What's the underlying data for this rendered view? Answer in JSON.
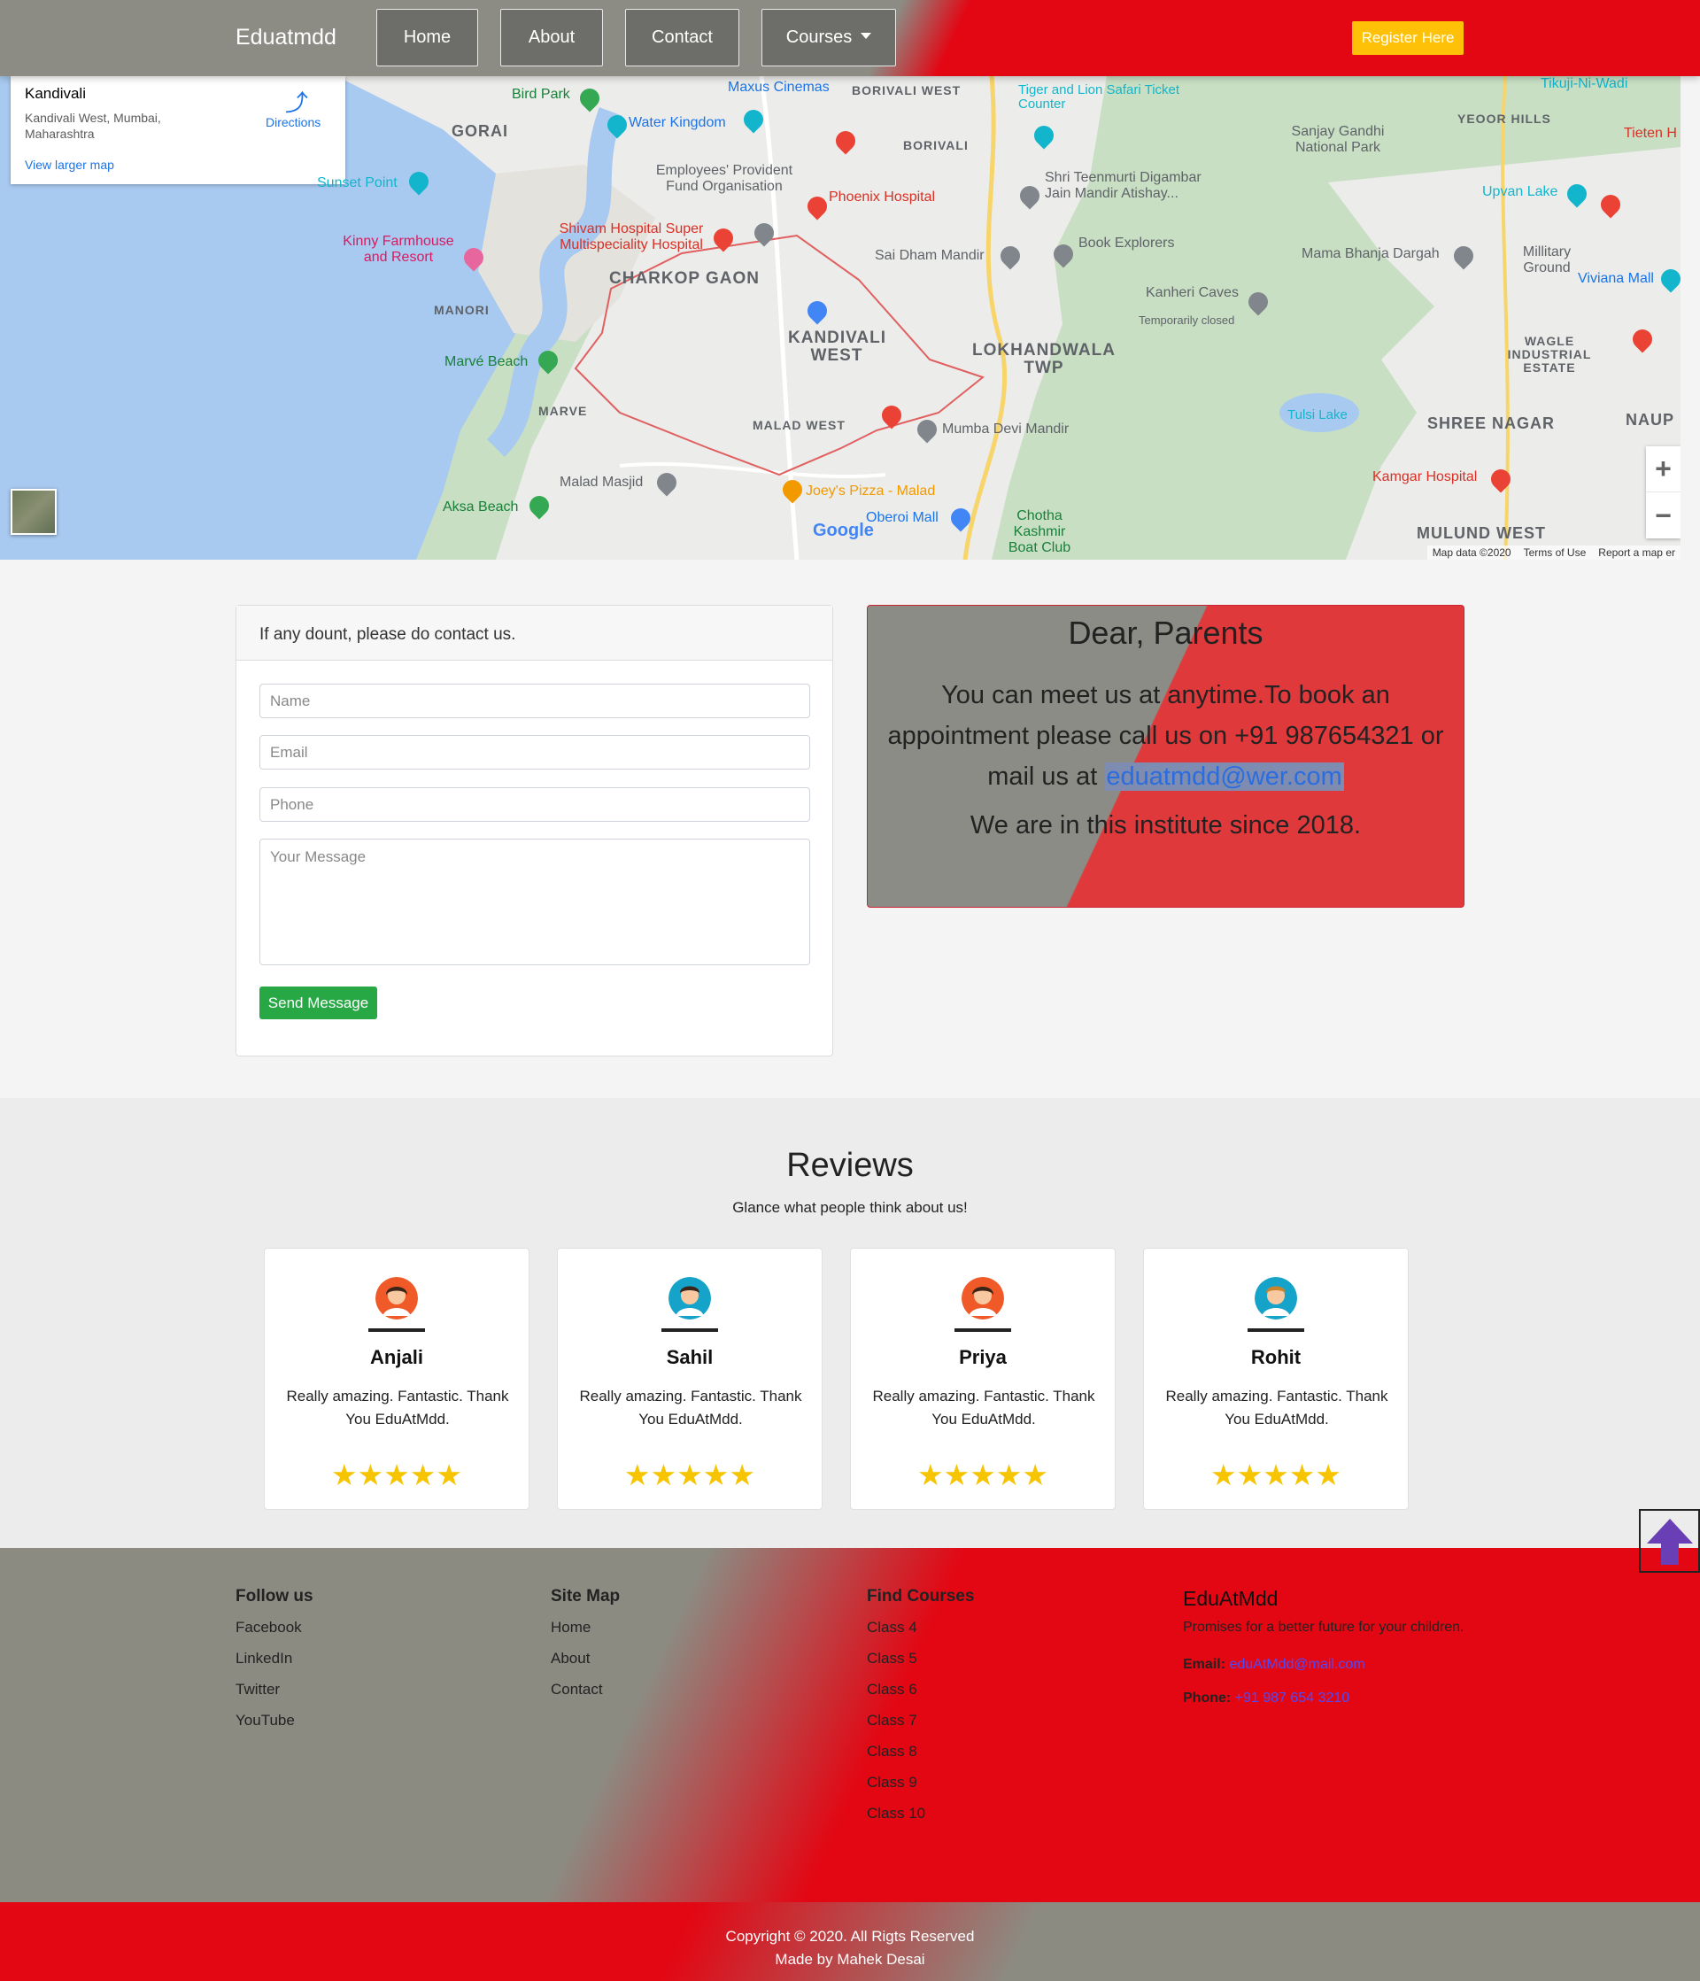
{
  "navbar": {
    "brand": "Eduatmdd",
    "items": [
      {
        "label": "Home"
      },
      {
        "label": "About"
      },
      {
        "label": "Contact"
      },
      {
        "label": "Courses"
      }
    ],
    "register_label": "Register Here"
  },
  "map": {
    "place_title": "Kandivali",
    "place_address": "Kandivali West, Mumbai, Maharashtra",
    "directions_label": "Directions",
    "view_larger": "View larger map",
    "labels": {
      "bird_park": "Bird Park",
      "maxus": "Maxus Cinemas",
      "borivali_west": "BORIVALI WEST",
      "tiger_safari": "Tiger and Lion Safari Ticket Counter",
      "gorai": "GORAI",
      "water_kingdom": "Water Kingdom",
      "sanjay_gandhi": "Sanjay Gandhi National Park",
      "yeoor_hills": "YEOOR HILLS",
      "tikuji": "Tikuji-Ni-Wadi",
      "borivali": "BORIVALI",
      "sunset_point": "Sunset Point",
      "employees_pf": "Employees' Provident Fund Organisation",
      "shri_teenmurti": "Shri Teenmurti Digambar Jain Mandir Atishay...",
      "upvan_lake": "Upvan Lake",
      "phoenix": "Phoenix Hospital",
      "kinny": "Kinny Farmhouse and Resort",
      "shivam": "Shivam Hospital Super Multispeciality Hospital",
      "sai_dham": "Sai Dham Mandir",
      "book_explorers": "Book Explorers",
      "mama_bhanja": "Mama Bhanja Dargah",
      "millitary": "Millitary Ground",
      "charkop": "CHARKOP GAON",
      "manori": "MANORI",
      "kanheri": "Kanheri Caves",
      "kanheri_sub": "Temporarily closed",
      "viviana": "Viviana Mall",
      "kandivali_west": "KANDIVALI WEST",
      "lokhandwala": "LOKHANDWALA TWP",
      "marve_beach": "Marvé Beach",
      "wagle": "WAGLE INDUSTRIAL ESTATE",
      "marve": "MARVE",
      "malad_west": "MALAD WEST",
      "mumba_devi": "Mumba Devi Mandir",
      "tulsi_lake": "Tulsi Lake",
      "shree_nagar": "SHREE NAGAR",
      "naup": "NAUP",
      "malad_masjid": "Malad Masjid",
      "joeys": "Joey's Pizza - Malad",
      "kamgar": "Kamgar Hospital",
      "aksa": "Aksa Beach",
      "oberoi": "Oberoi Mall",
      "chotha": "Chotha Kashmir Boat Club",
      "mulund": "MULUND WEST",
      "tieten": "Tieten H"
    },
    "google": "Google",
    "footer": [
      "Map data ©2020",
      "Terms of Use",
      "Report a map er"
    ],
    "zoom_in": "+",
    "zoom_out": "−"
  },
  "contact_form": {
    "header": "If any dount, please do contact us.",
    "name_placeholder": "Name",
    "email_placeholder": "Email",
    "phone_placeholder": "Phone",
    "message_placeholder": "Your Message",
    "send_label": "Send Message"
  },
  "parents": {
    "title": "Dear, Parents",
    "body_prefix": "You can meet us at anytime.To book an appointment please call us on +91 987654321 or mail us at ",
    "email": "eduatmdd@wer.com",
    "since": "We are in this institute since 2018."
  },
  "reviews": {
    "title": "Reviews",
    "subtitle": "Glance what people think about us!",
    "items": [
      {
        "name": "Anjali",
        "text": "Really amazing. Fantastic. Thank You EduAtMdd.",
        "rating": 5,
        "avatar_color": "#ef5a28"
      },
      {
        "name": "Sahil",
        "text": "Really amazing. Fantastic. Thank You EduAtMdd.",
        "rating": 5,
        "avatar_color": "#16a3c9"
      },
      {
        "name": "Priya",
        "text": "Really amazing. Fantastic. Thank You EduAtMdd.",
        "rating": 5,
        "avatar_color": "#ef5a28"
      },
      {
        "name": "Rohit",
        "text": "Really amazing. Fantastic. Thank You EduAtMdd.",
        "rating": 5,
        "avatar_color": "#16a3c9"
      }
    ],
    "stars": "★★★★★"
  },
  "footer": {
    "follow": {
      "title": "Follow us",
      "links": [
        "Facebook",
        "LinkedIn",
        "Twitter",
        "YouTube"
      ]
    },
    "sitemap": {
      "title": "Site Map",
      "links": [
        "Home",
        "About",
        "Contact"
      ]
    },
    "courses": {
      "title": "Find Courses",
      "links": [
        "Class 4",
        "Class 5",
        "Class 6",
        "Class 7",
        "Class 8",
        "Class 9",
        "Class 10"
      ]
    },
    "brand": {
      "name": "EduAtMdd",
      "tagline": "Promises for a better future for your children.",
      "email_label": "Email:",
      "email": "eduAtMdd@mail.com",
      "phone_label": "Phone:",
      "phone": "+91 987 654 3210"
    },
    "copyright": "Copyright © 2020. All Rigts Reserved",
    "made_by": "Made by Mahek Desai"
  },
  "colors": {
    "navbar_grey": "#8c8c84",
    "navbar_red": "#e30613",
    "register_yellow": "#ffc107",
    "send_green": "#28a745",
    "star_yellow": "#f6c400",
    "scroll_arrow": "#6a3fb5"
  }
}
